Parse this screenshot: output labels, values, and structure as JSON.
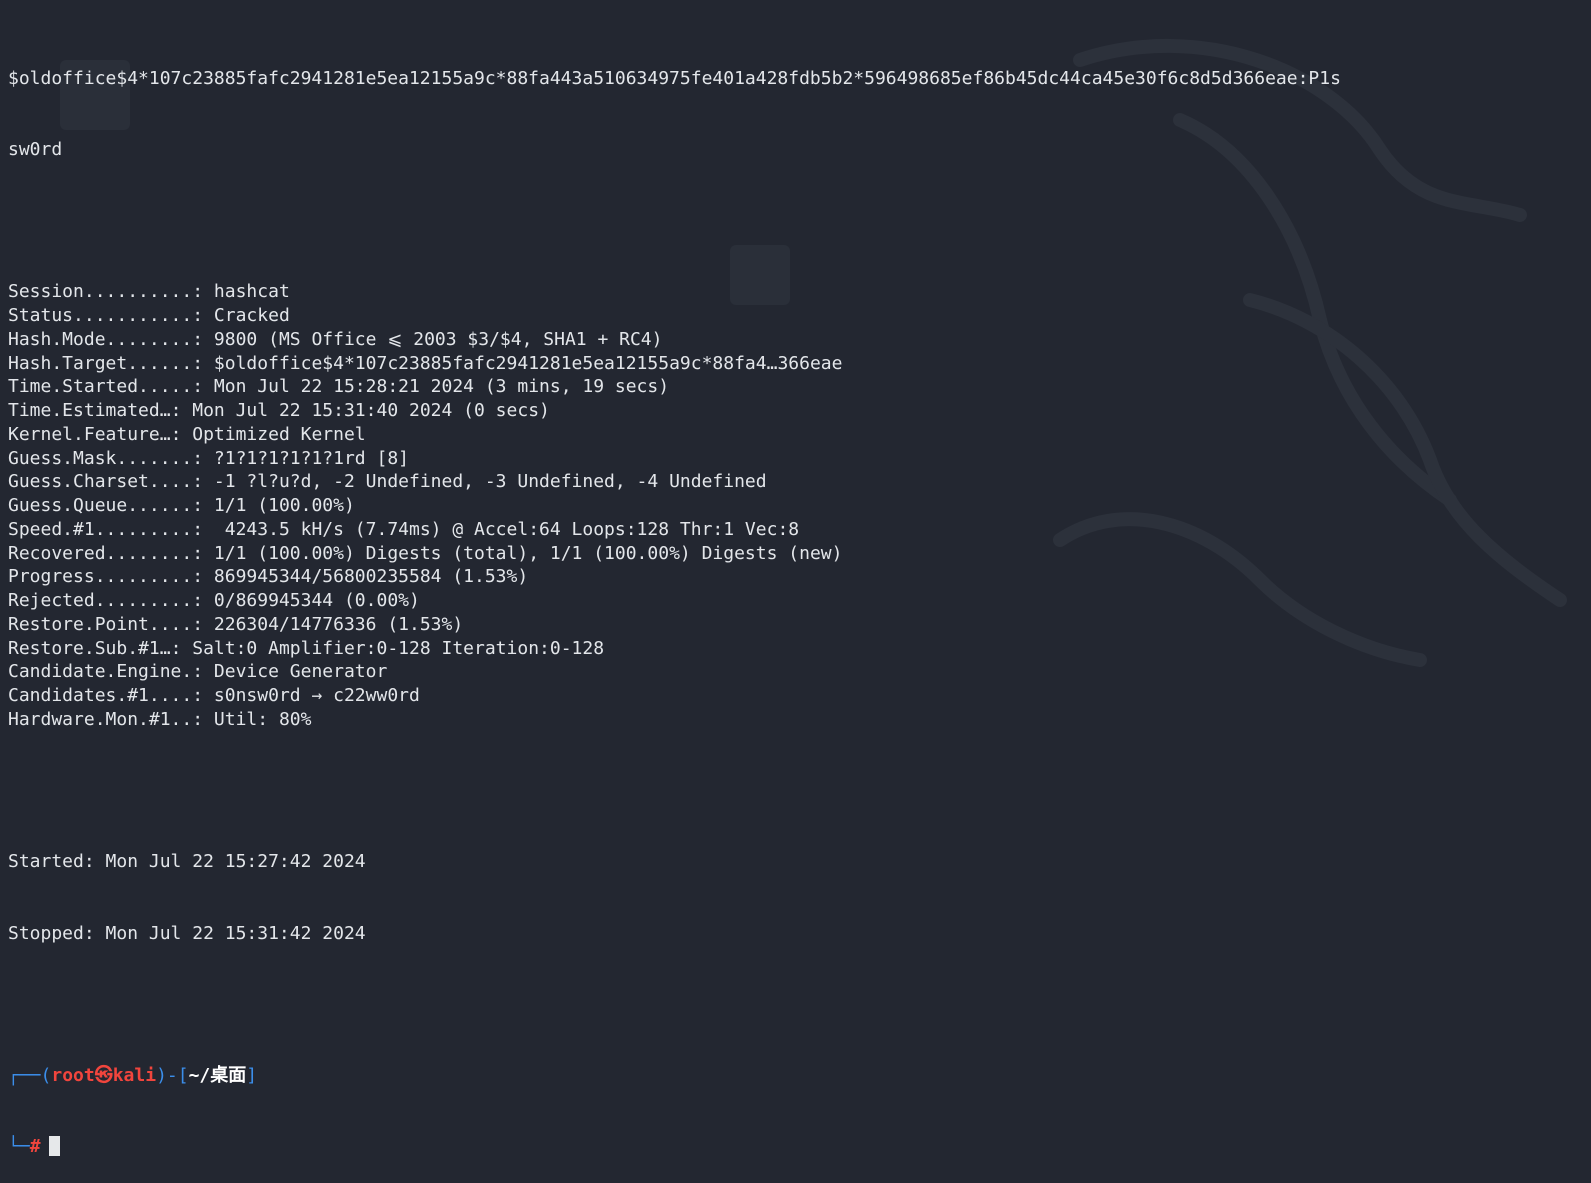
{
  "terminal": {
    "hash_line_1": "$oldoffice$4*107c23885fafc2941281e5ea12155a9c*88fa443a510634975fe401a428fdb5b2*596498685ef86b45dc44ca45e30f6c8d5d366eae:P1s",
    "hash_line_2": "sw0rd",
    "status": [
      {
        "key": "Session..........",
        "value": "hashcat"
      },
      {
        "key": "Status...........",
        "value": "Cracked"
      },
      {
        "key": "Hash.Mode........",
        "value": "9800 (MS Office ⩽ 2003 $3/$4, SHA1 + RC4)"
      },
      {
        "key": "Hash.Target......",
        "value": "$oldoffice$4*107c23885fafc2941281e5ea12155a9c*88fa4…366eae"
      },
      {
        "key": "Time.Started.....",
        "value": "Mon Jul 22 15:28:21 2024 (3 mins, 19 secs)"
      },
      {
        "key": "Time.Estimated…",
        "value": "Mon Jul 22 15:31:40 2024 (0 secs)"
      },
      {
        "key": "Kernel.Feature…",
        "value": "Optimized Kernel"
      },
      {
        "key": "Guess.Mask.......",
        "value": "?1?1?1?1?1?1rd [8]"
      },
      {
        "key": "Guess.Charset....",
        "value": "-1 ?l?u?d, -2 Undefined, -3 Undefined, -4 Undefined"
      },
      {
        "key": "Guess.Queue......",
        "value": "1/1 (100.00%)"
      },
      {
        "key": "Speed.#1.........",
        "value": " 4243.5 kH/s (7.74ms) @ Accel:64 Loops:128 Thr:1 Vec:8"
      },
      {
        "key": "Recovered........",
        "value": "1/1 (100.00%) Digests (total), 1/1 (100.00%) Digests (new)"
      },
      {
        "key": "Progress.........",
        "value": "869945344/56800235584 (1.53%)"
      },
      {
        "key": "Rejected.........",
        "value": "0/869945344 (0.00%)"
      },
      {
        "key": "Restore.Point....",
        "value": "226304/14776336 (1.53%)"
      },
      {
        "key": "Restore.Sub.#1…",
        "value": "Salt:0 Amplifier:0-128 Iteration:0-128"
      },
      {
        "key": "Candidate.Engine.",
        "value": "Device Generator"
      },
      {
        "key": "Candidates.#1....",
        "value": "s0nsw0rd → c22ww0rd"
      },
      {
        "key": "Hardware.Mon.#1..",
        "value": "Util: 80%"
      }
    ],
    "started": "Started: Mon Jul 22 15:27:42 2024",
    "stopped": "Stopped: Mon Jul 22 15:31:42 2024",
    "prompt": {
      "corner_top": "┌──(",
      "user": "root㉿kali",
      "mid": ")-[",
      "path": "~/桌面",
      "end": "]",
      "corner_bottom": "└─",
      "hash": "#"
    }
  },
  "colors": {
    "background": "#232731",
    "text": "#e3e6ea",
    "prompt_blue": "#3b8eea",
    "prompt_red": "#f1453d"
  }
}
